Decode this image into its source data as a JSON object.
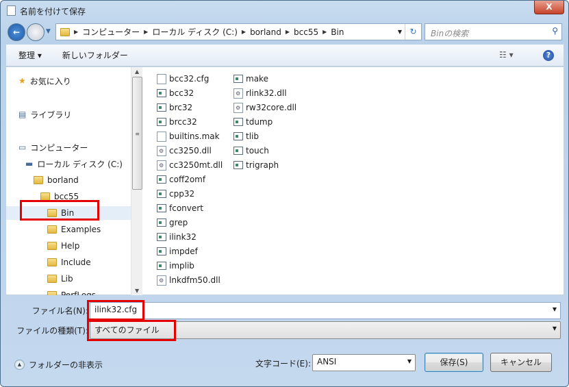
{
  "window": {
    "title": "名前を付けて保存",
    "close_label": "X"
  },
  "address": {
    "crumbs": [
      "コンピューター",
      "ローカル ディスク (C:)",
      "borland",
      "bcc55",
      "Bin"
    ]
  },
  "search": {
    "placeholder": "Binの検索"
  },
  "toolbar": {
    "organize": "整理 ▾",
    "new_folder": "新しいフォルダー"
  },
  "tree": [
    {
      "label": "お気に入り",
      "icon": "star-icon"
    },
    {
      "label": "ライブラリ",
      "icon": "library-icon"
    },
    {
      "label": "コンピューター",
      "icon": "computer-icon"
    },
    {
      "label": "ローカル ディスク (C:)",
      "icon": "drive-icon"
    },
    {
      "label": "borland",
      "icon": "folder-icon"
    },
    {
      "label": "bcc55",
      "icon": "folder-icon"
    },
    {
      "label": "Bin",
      "icon": "folder-icon",
      "selected": true
    },
    {
      "label": "Examples",
      "icon": "folder-icon"
    },
    {
      "label": "Help",
      "icon": "folder-icon"
    },
    {
      "label": "Include",
      "icon": "folder-icon"
    },
    {
      "label": "Lib",
      "icon": "folder-icon"
    },
    {
      "label": "PerfLogs",
      "icon": "folder-icon"
    }
  ],
  "files": [
    {
      "name": "bcc32.cfg",
      "type": "file"
    },
    {
      "name": "bcc32",
      "type": "exe"
    },
    {
      "name": "brc32",
      "type": "exe"
    },
    {
      "name": "brcc32",
      "type": "exe"
    },
    {
      "name": "builtins.mak",
      "type": "file"
    },
    {
      "name": "cc3250.dll",
      "type": "dll"
    },
    {
      "name": "cc3250mt.dll",
      "type": "dll"
    },
    {
      "name": "coff2omf",
      "type": "exe"
    },
    {
      "name": "cpp32",
      "type": "exe"
    },
    {
      "name": "fconvert",
      "type": "exe"
    },
    {
      "name": "grep",
      "type": "exe"
    },
    {
      "name": "ilink32",
      "type": "exe"
    },
    {
      "name": "impdef",
      "type": "exe"
    },
    {
      "name": "implib",
      "type": "exe"
    },
    {
      "name": "lnkdfm50.dll",
      "type": "dll"
    },
    {
      "name": "make",
      "type": "exe"
    },
    {
      "name": "rlink32.dll",
      "type": "dll"
    },
    {
      "name": "rw32core.dll",
      "type": "dll"
    },
    {
      "name": "tdump",
      "type": "exe"
    },
    {
      "name": "tlib",
      "type": "exe"
    },
    {
      "name": "touch",
      "type": "exe"
    },
    {
      "name": "trigraph",
      "type": "exe"
    }
  ],
  "form": {
    "filename_label": "ファイル名(N):",
    "filename_value": "ilink32.cfg",
    "filetype_label": "ファイルの種類(T):",
    "filetype_value": "すべてのファイル",
    "encoding_label": "文字コード(E):",
    "encoding_value": "ANSI",
    "save": "保存(S)",
    "cancel": "キャンセル",
    "hide_folders": "フォルダーの非表示"
  },
  "highlight_color": "#e40000"
}
